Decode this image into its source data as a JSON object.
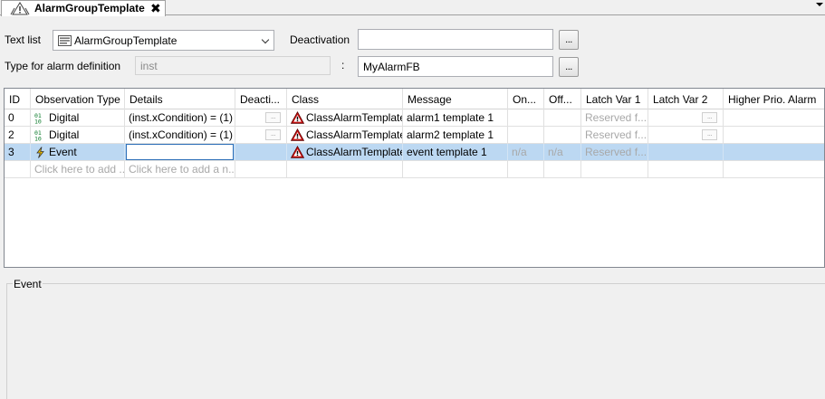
{
  "tab": {
    "title": "AlarmGroupTemplate",
    "close_glyph": "✖"
  },
  "form": {
    "text_list_label": "Text list",
    "text_list_value": "AlarmGroupTemplate",
    "deactivation_label": "Deactivation",
    "deactivation_value": "",
    "type_label": "Type for alarm definition",
    "type_value": "inst",
    "colon": ":",
    "type_fb_value": "MyAlarmFB",
    "browse_label": "..."
  },
  "grid": {
    "columns": [
      "ID",
      "Observation Type",
      "Details",
      "Deacti...",
      "Class",
      "Message",
      "On...",
      "Off...",
      "Latch Var 1",
      "Latch Var 2",
      "Higher Prio. Alarm"
    ],
    "rows": [
      {
        "id": "0",
        "type": "Digital",
        "type_icon": "digital-icon",
        "details": "(inst.xCondition) = (1)",
        "class": "ClassAlarmTemplate",
        "message": "alarm1 template 1",
        "on": "",
        "off": "",
        "latch1": "Reserved f..."
      },
      {
        "id": "2",
        "type": "Digital",
        "type_icon": "digital-icon",
        "details": "(inst.xCondition) = (1)",
        "class": "ClassAlarmTemplate",
        "message": "alarm2 template 1",
        "on": "",
        "off": "",
        "latch1": "Reserved f..."
      },
      {
        "id": "3",
        "type": "Event",
        "type_icon": "event-icon",
        "details": "",
        "class": "ClassAlarmTemplate",
        "message": "event template 1",
        "on": "n/a",
        "off": "n/a",
        "latch1": "Reserved f..."
      }
    ],
    "new_row": {
      "type": "Click here to add ...",
      "details": "Click here to add a n..."
    },
    "mini_button": "..."
  },
  "detail_group": {
    "title": "Event"
  },
  "colors": {
    "selected_row": "#bcd8f2",
    "alarm_icon": "#cc1010",
    "edit_border": "#2c6fb8"
  }
}
